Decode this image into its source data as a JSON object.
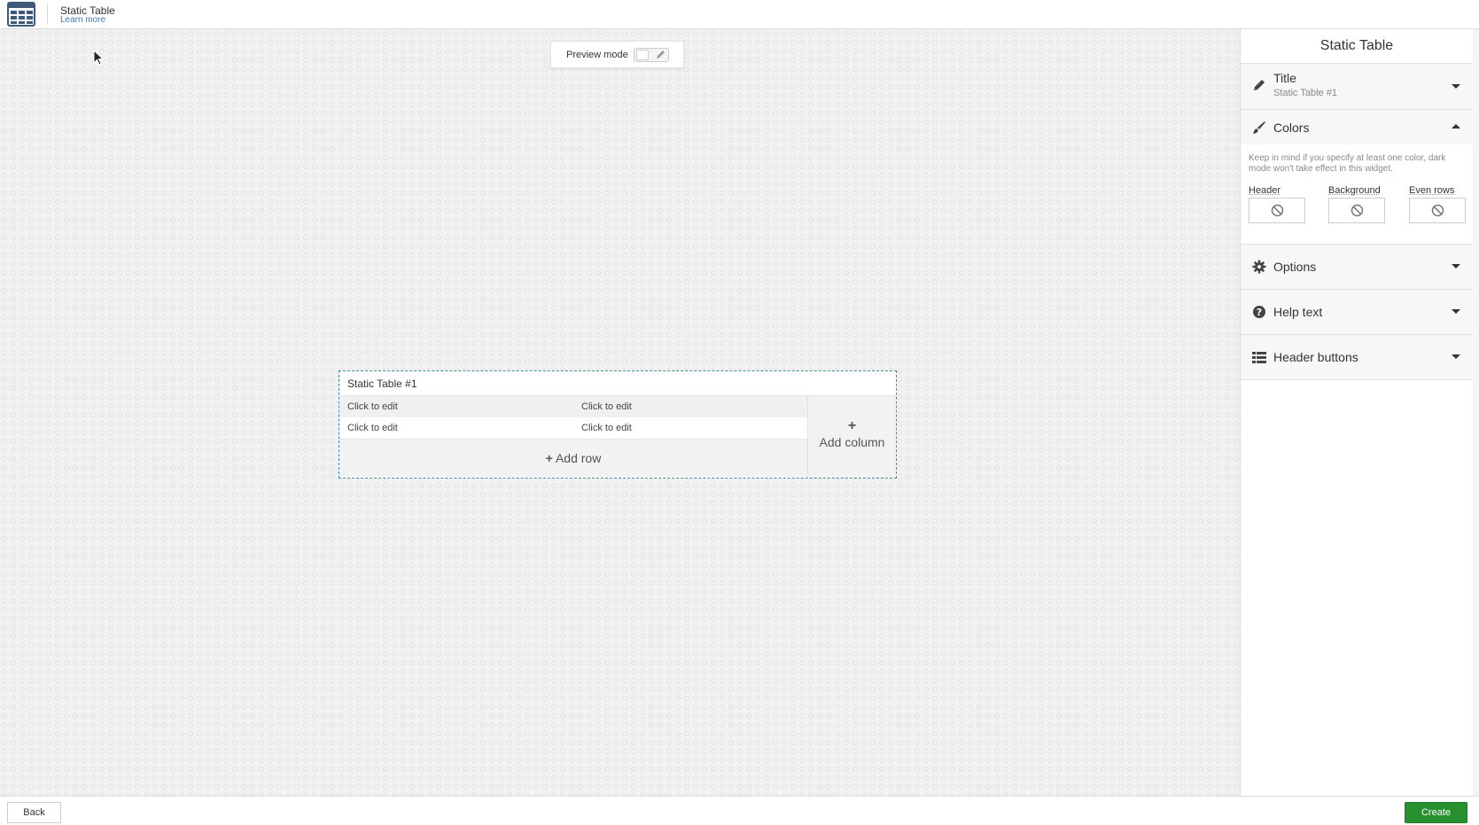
{
  "header": {
    "title": "Static Table",
    "learn_more": "Learn more",
    "app_icon": "table-grid-icon"
  },
  "canvas": {
    "preview": {
      "label": "Preview mode",
      "enabled": false
    },
    "widget": {
      "title": "Static Table #1",
      "rows": [
        [
          "Click to edit",
          "Click to edit"
        ],
        [
          "Click to edit",
          "Click to edit"
        ]
      ],
      "add_row_label": "Add row",
      "add_column_label": "Add column"
    }
  },
  "sidebar": {
    "title": "Static Table",
    "sections": {
      "title": {
        "label": "Title",
        "value": "Static Table #1",
        "icon": "pencil-icon"
      },
      "colors": {
        "label": "Colors",
        "icon": "paintbrush-icon",
        "note": "Keep in mind if you specify at least one color, dark mode won't take effect in this widget.",
        "fields": [
          {
            "label": "Header",
            "value": "none"
          },
          {
            "label": "Background",
            "value": "none"
          },
          {
            "label": "Even rows",
            "value": "none"
          }
        ]
      },
      "options": {
        "label": "Options",
        "icon": "gear-icon"
      },
      "help_text": {
        "label": "Help text",
        "icon": "question-circle-icon"
      },
      "header_buttons": {
        "label": "Header buttons",
        "icon": "list-icon"
      }
    }
  },
  "footer": {
    "back_label": "Back",
    "create_label": "Create"
  },
  "colors": {
    "accent_green": "#28912f",
    "link_blue": "#3a7bbf",
    "widget_border": "#3f8aa8"
  }
}
